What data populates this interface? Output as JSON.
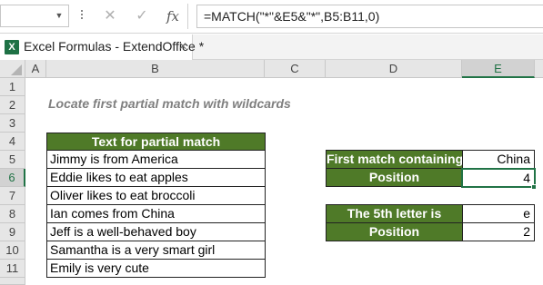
{
  "formula_bar": {
    "name_box": "",
    "cancel_glyph": "✕",
    "enter_glyph": "✓",
    "fx_glyph": "fx",
    "formula": "=MATCH(\"*\"&E5&\"*\",B5:B11,0)"
  },
  "window": {
    "app_icon": "X",
    "title": "Excel Formulas - ExtendOffice *",
    "close_glyph": "✕"
  },
  "columns": [
    "A",
    "B",
    "C",
    "D",
    "E"
  ],
  "rows": [
    "1",
    "2",
    "3",
    "4",
    "5",
    "6",
    "7",
    "8",
    "9",
    "10",
    "11"
  ],
  "selected": {
    "column": "E",
    "row": "6"
  },
  "sheet": {
    "subtitle": "Locate first partial match with wildcards",
    "list_header": "Text for partial match",
    "list_items": [
      "Jimmy is from America",
      "Eddie likes to eat apples",
      "Oliver likes to eat broccoli",
      "Ian comes from China",
      "Jeff is a well-behaved boy",
      "Samantha is a very smart girl",
      "Emily is very cute"
    ],
    "lookup": {
      "label1": "First match containing",
      "value1": "China",
      "label2": "Position",
      "value2": "4"
    },
    "letter": {
      "label1": "The 5th letter is",
      "value1": "e",
      "label2": "Position",
      "value2": "2"
    }
  },
  "colors": {
    "header_green": "#4f7a28",
    "selection_green": "#217346"
  }
}
